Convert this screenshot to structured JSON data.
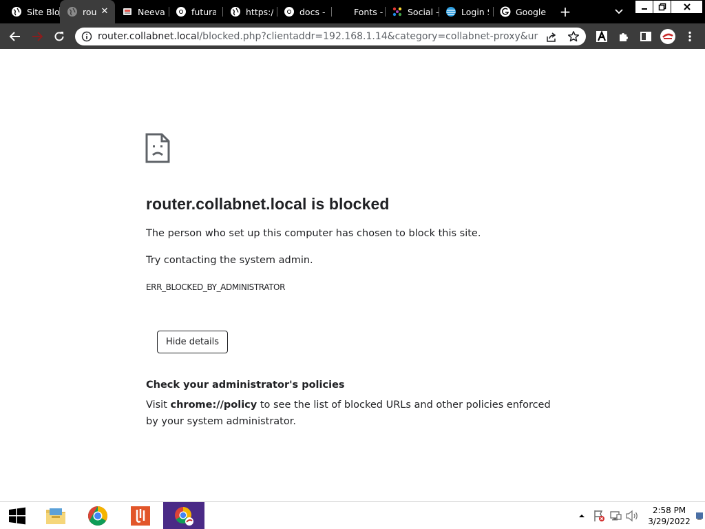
{
  "browser": {
    "tabs": [
      {
        "title": "Site Blo",
        "icon": "globe-icon",
        "active": false
      },
      {
        "title": "rou",
        "icon": "globe-icon",
        "active": true
      },
      {
        "title": "Neeva",
        "icon": "neeva-icon",
        "active": false
      },
      {
        "title": "futura f",
        "icon": "chrome-icon",
        "active": false
      },
      {
        "title": "https://",
        "icon": "globe-icon",
        "active": false
      },
      {
        "title": "docs - \\",
        "icon": "chrome-icon",
        "active": false
      },
      {
        "title": "Fonts -",
        "icon": "fonts-icon",
        "active": false
      },
      {
        "title": "Social -",
        "icon": "social-icon",
        "active": false
      },
      {
        "title": "Login S",
        "icon": "att-icon",
        "active": false
      },
      {
        "title": "Google",
        "icon": "google-icon",
        "active": false
      }
    ],
    "address": {
      "host": "router.collabnet.local",
      "path": "/blocked.php?clientaddr=192.168.1.14&category=collabnet-proxy&url=protonv..."
    }
  },
  "page": {
    "heading": "router.collabnet.local is blocked",
    "line1": "The person who set up this computer has chosen to block this site.",
    "line2": "Try contacting the system admin.",
    "error_code": "ERR_BLOCKED_BY_ADMINISTRATOR",
    "hide_details_label": "Hide details",
    "policy_heading": "Check your administrator's policies",
    "policy_prefix": "Visit ",
    "policy_link": "chrome://policy",
    "policy_suffix": " to see the list of blocked URLs and other policies enforced by your system administrator."
  },
  "taskbar": {
    "time": "2:58 PM",
    "date": "3/29/2022"
  },
  "colors": {
    "tabstrip": "#000000",
    "toolbar": "#3c3c3c",
    "active_tab": "#3c3c3c",
    "taskbar_active": "#4a2a86",
    "text": "#202124"
  }
}
